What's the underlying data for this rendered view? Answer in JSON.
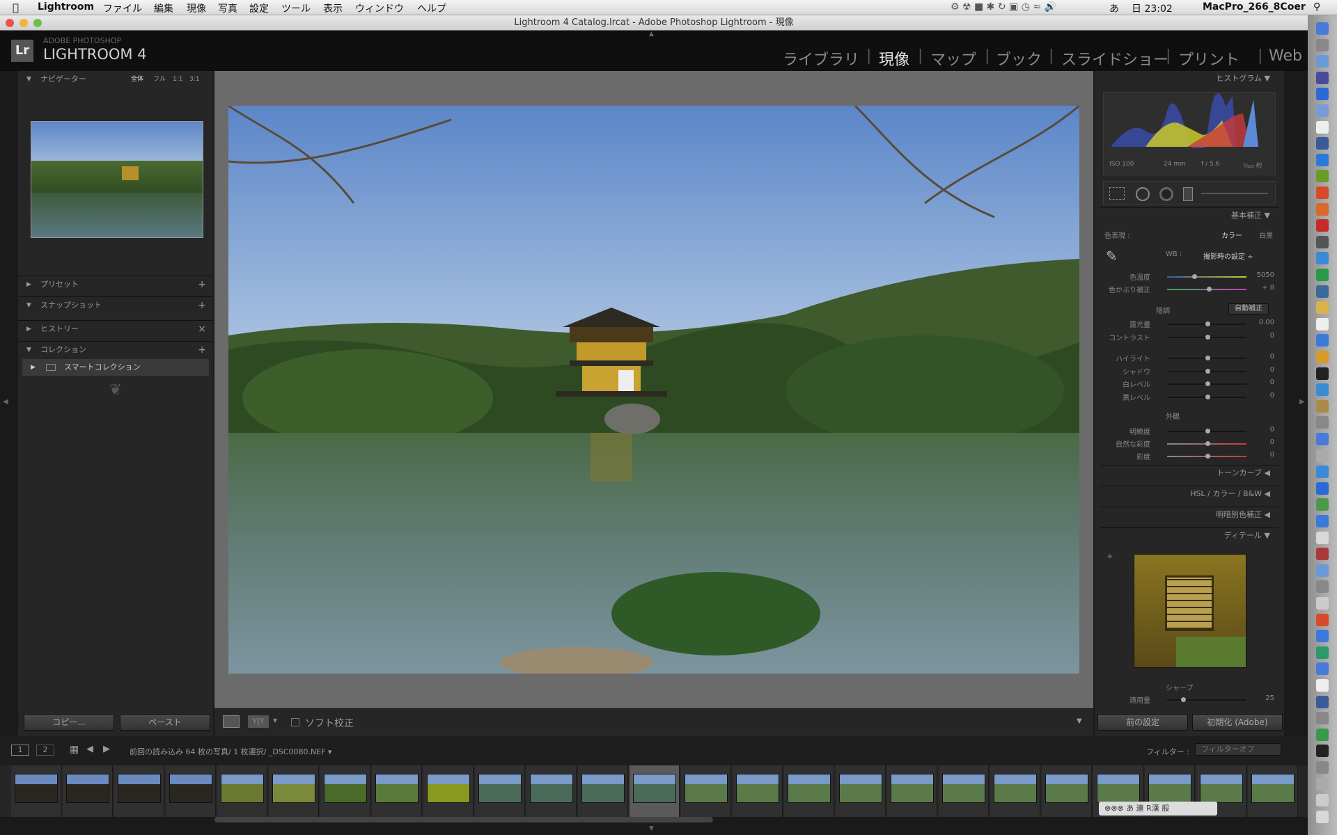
{
  "menubar": {
    "app": "Lightroom",
    "items": [
      "ファイル",
      "編集",
      "現像",
      "写真",
      "設定",
      "ツール",
      "表示",
      "ウィンドウ",
      "ヘルプ"
    ],
    "clock": "日 23:02",
    "host": "MacPro_266_8Coer",
    "input_method": "あ"
  },
  "window": {
    "title": "Lightroom 4 Catalog.lrcat - Adobe Photoshop Lightroom - 現像"
  },
  "header": {
    "brand_top": "ADOBE PHOTOSHOP",
    "brand_main": "LIGHTROOM 4",
    "lr_mark": "Lr",
    "modules": [
      "ライブラリ",
      "現像",
      "マップ",
      "ブック",
      "スライドショー",
      "プリント",
      "Web"
    ],
    "active_module": "現像",
    "separator": "|"
  },
  "left": {
    "navigator": {
      "title": "ナビゲーター",
      "zoom": [
        "全体",
        "フル",
        "1:1",
        "3:1"
      ]
    },
    "presets": "プリセット",
    "snapshots": "スナップショット",
    "history": "ヒストリー",
    "collections": "コレクション",
    "smart_collection": "スマートコレクション",
    "copy_button": "コピー...",
    "paste_button": "ペースト"
  },
  "toolbar": {
    "soft_proof": "ソフト校正",
    "yy": "Y|Y"
  },
  "right": {
    "histogram": {
      "title": "ヒストグラム",
      "iso": "ISO 100",
      "focal": "24 mm",
      "aperture": "f / 5.6",
      "shutter": "¹⁄₃₂₀ 秒"
    },
    "basic": {
      "title": "基本補正",
      "treatment_label": "色表現 :",
      "color": "カラー",
      "bw": "白黒",
      "wb_label": "WB :",
      "wb_value": "撮影時の設定 ÷",
      "sliders_wb": [
        {
          "label": "色温度",
          "value": "5050",
          "pos": 0.33
        },
        {
          "label": "色かぶり補正",
          "value": "+ 8",
          "pos": 0.52
        }
      ],
      "tone_label": "階調",
      "auto": "自動補正",
      "sliders_tone": [
        {
          "label": "露光量",
          "value": "0.00",
          "pos": 0.5
        },
        {
          "label": "コントラスト",
          "value": "0",
          "pos": 0.5
        },
        {
          "label": "ハイライト",
          "value": "0",
          "pos": 0.5
        },
        {
          "label": "シャドウ",
          "value": "0",
          "pos": 0.5
        },
        {
          "label": "白レベル",
          "value": "0",
          "pos": 0.5
        },
        {
          "label": "黒レベル",
          "value": "0",
          "pos": 0.5
        }
      ],
      "presence_label": "外観",
      "sliders_presence": [
        {
          "label": "明瞭度",
          "value": "0",
          "pos": 0.5
        },
        {
          "label": "自然な彩度",
          "value": "0",
          "pos": 0.5
        },
        {
          "label": "彩度",
          "value": "0",
          "pos": 0.5
        }
      ]
    },
    "tone_curve": "トーンカーブ",
    "hsl": "HSL / カラー / B&W",
    "split_toning": "明暗別色補正",
    "detail": "ディテール",
    "sharpen_label": "シャープ",
    "sharpen_amount_label": "適用量",
    "sharpen_amount": "25",
    "prev_button": "前の設定",
    "reset_button": "初期化 (Adobe)"
  },
  "filmbar": {
    "page1": "1",
    "page2": "2",
    "info": "前回の読み込み  64 枚の写真/ 1 枚選択/ _DSC0080.NEF ▾",
    "filter_label": "フィルター :",
    "filter_value": "フィルターオフ"
  },
  "ime": {
    "text": "あ 連 R漢 般"
  },
  "colors": {
    "accent": "#d8d8d8",
    "panel": "#262626",
    "center": "#6b6b6b"
  }
}
